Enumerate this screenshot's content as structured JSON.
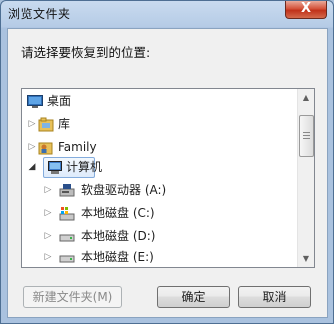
{
  "window": {
    "title": "浏览文件夹",
    "close_glyph": "X",
    "prompt": "请选择要恢复到的位置:"
  },
  "tree": {
    "items": [
      {
        "label": "桌面",
        "icon": "desktop-icon",
        "level": 0,
        "expander": "none"
      },
      {
        "label": "库",
        "icon": "libraries-icon",
        "level": 1,
        "expander": "collapsed"
      },
      {
        "label": "Family",
        "icon": "user-folder-icon",
        "level": 1,
        "expander": "collapsed"
      },
      {
        "label": "计算机",
        "icon": "computer-icon",
        "level": 1,
        "expander": "expanded",
        "selected": true
      },
      {
        "label": "软盘驱动器 (A:)",
        "icon": "floppy-drive-icon",
        "level": 2,
        "expander": "collapsed"
      },
      {
        "label": "本地磁盘 (C:)",
        "icon": "system-drive-icon",
        "level": 2,
        "expander": "collapsed"
      },
      {
        "label": "本地磁盘 (D:)",
        "icon": "hard-drive-icon",
        "level": 2,
        "expander": "collapsed"
      },
      {
        "label": "本地磁盘 (E:)",
        "icon": "hard-drive-icon",
        "level": 2,
        "expander": "collapsed"
      }
    ]
  },
  "buttons": {
    "new_folder": "新建文件夹(M)",
    "ok": "确定",
    "cancel": "取消"
  },
  "colors": {
    "selection_border": "#84acdd",
    "frame": "#aac2df",
    "close": "#c0311a"
  }
}
